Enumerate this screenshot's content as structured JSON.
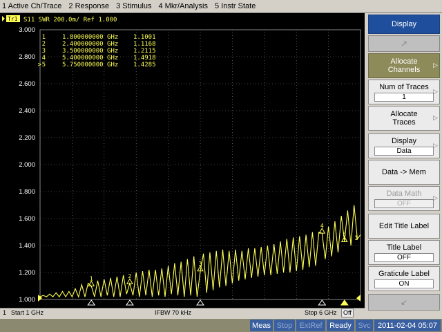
{
  "menu": [
    {
      "label": "1 Active Ch/Trace"
    },
    {
      "label": "2 Response"
    },
    {
      "label": "3 Stimulus"
    },
    {
      "label": "4 Mkr/Analysis"
    },
    {
      "label": "5 Instr State"
    }
  ],
  "trace": {
    "badge": "Tr1",
    "info": "S11  SWR 200.0m/ Ref 1.000",
    "color": "#ffff55"
  },
  "markers": [
    {
      "index": "1",
      "prefix": "",
      "freq": "1.800000000 GHz",
      "value": "1.1001"
    },
    {
      "index": "2",
      "prefix": "",
      "freq": "2.400000000 GHz",
      "value": "1.1168"
    },
    {
      "index": "3",
      "prefix": "",
      "freq": "3.500000000 GHz",
      "value": "1.2115"
    },
    {
      "index": "4",
      "prefix": "",
      "freq": "5.400000000 GHz",
      "value": "1.4918"
    },
    {
      "index": "5",
      "prefix": ">",
      "freq": "5.750000000 GHz",
      "value": "1.4285"
    }
  ],
  "chart_data": {
    "type": "line",
    "title": "S11  SWR 200.0m/ Ref 1.000",
    "xlabel": "",
    "ylabel": "",
    "xlim": [
      1,
      6
    ],
    "ylim": [
      1.0,
      3.0
    ],
    "yticks": [
      "3.000",
      "2.800",
      "2.600",
      "2.400",
      "2.200",
      "2.000",
      "1.800",
      "1.600",
      "1.400",
      "1.200",
      "1.000"
    ],
    "grid": true,
    "series": [
      {
        "points": [
          [
            1.0,
            1.02
          ],
          [
            1.05,
            1.03
          ],
          [
            1.1,
            1.02
          ],
          [
            1.15,
            1.04
          ],
          [
            1.2,
            1.02
          ],
          [
            1.25,
            1.05
          ],
          [
            1.3,
            1.02
          ],
          [
            1.35,
            1.06
          ],
          [
            1.4,
            1.02
          ],
          [
            1.45,
            1.06
          ],
          [
            1.5,
            1.02
          ],
          [
            1.55,
            1.08
          ],
          [
            1.6,
            1.02
          ],
          [
            1.65,
            1.11
          ],
          [
            1.7,
            1.02
          ],
          [
            1.75,
            1.12
          ],
          [
            1.8,
            1.1
          ],
          [
            1.85,
            1.02
          ],
          [
            1.9,
            1.14
          ],
          [
            1.95,
            1.02
          ],
          [
            2.0,
            1.15
          ],
          [
            2.05,
            1.03
          ],
          [
            2.1,
            1.16
          ],
          [
            2.15,
            1.02
          ],
          [
            2.2,
            1.17
          ],
          [
            2.25,
            1.02
          ],
          [
            2.3,
            1.18
          ],
          [
            2.35,
            1.04
          ],
          [
            2.4,
            1.12
          ],
          [
            2.45,
            1.03
          ],
          [
            2.5,
            1.2
          ],
          [
            2.55,
            1.02
          ],
          [
            2.6,
            1.21
          ],
          [
            2.65,
            1.03
          ],
          [
            2.7,
            1.22
          ],
          [
            2.75,
            1.02
          ],
          [
            2.8,
            1.22
          ],
          [
            2.85,
            1.03
          ],
          [
            2.9,
            1.23
          ],
          [
            2.95,
            1.02
          ],
          [
            3.0,
            1.25
          ],
          [
            3.05,
            1.04
          ],
          [
            3.1,
            1.27
          ],
          [
            3.15,
            1.03
          ],
          [
            3.2,
            1.28
          ],
          [
            3.25,
            1.02
          ],
          [
            3.3,
            1.3
          ],
          [
            3.35,
            1.03
          ],
          [
            3.4,
            1.32
          ],
          [
            3.45,
            1.02
          ],
          [
            3.5,
            1.21
          ],
          [
            3.55,
            1.34
          ],
          [
            3.6,
            1.05
          ],
          [
            3.65,
            1.35
          ],
          [
            3.7,
            1.07
          ],
          [
            3.75,
            1.36
          ],
          [
            3.8,
            1.09
          ],
          [
            3.85,
            1.37
          ],
          [
            3.9,
            1.1
          ],
          [
            3.95,
            1.36
          ],
          [
            4.0,
            1.12
          ],
          [
            4.05,
            1.37
          ],
          [
            4.1,
            1.14
          ],
          [
            4.15,
            1.36
          ],
          [
            4.2,
            1.15
          ],
          [
            4.25,
            1.38
          ],
          [
            4.3,
            1.16
          ],
          [
            4.35,
            1.38
          ],
          [
            4.4,
            1.17
          ],
          [
            4.45,
            1.39
          ],
          [
            4.5,
            1.18
          ],
          [
            4.55,
            1.4
          ],
          [
            4.6,
            1.18
          ],
          [
            4.65,
            1.41
          ],
          [
            4.7,
            1.19
          ],
          [
            4.75,
            1.43
          ],
          [
            4.8,
            1.2
          ],
          [
            4.85,
            1.45
          ],
          [
            4.9,
            1.2
          ],
          [
            4.95,
            1.46
          ],
          [
            5.0,
            1.21
          ],
          [
            5.05,
            1.47
          ],
          [
            5.1,
            1.22
          ],
          [
            5.15,
            1.48
          ],
          [
            5.2,
            1.24
          ],
          [
            5.25,
            1.5
          ],
          [
            5.3,
            1.25
          ],
          [
            5.35,
            1.5
          ],
          [
            5.4,
            1.49
          ],
          [
            5.45,
            1.3
          ],
          [
            5.5,
            1.54
          ],
          [
            5.55,
            1.32
          ],
          [
            5.6,
            1.58
          ],
          [
            5.65,
            1.35
          ],
          [
            5.7,
            1.62
          ],
          [
            5.75,
            1.43
          ],
          [
            5.8,
            1.66
          ],
          [
            5.85,
            1.4
          ],
          [
            5.9,
            1.7
          ],
          [
            5.95,
            1.45
          ],
          [
            6.0,
            1.48
          ]
        ]
      }
    ],
    "marker_points": [
      {
        "label": "1",
        "x": 1.8,
        "y": 1.1001
      },
      {
        "label": "2",
        "x": 2.4,
        "y": 1.1168
      },
      {
        "label": "3",
        "x": 3.5,
        "y": 1.2115
      },
      {
        "label": "4",
        "x": 5.4,
        "y": 1.4918
      },
      {
        "label": "5",
        "x": 5.75,
        "y": 1.4285
      }
    ],
    "end_label": "1"
  },
  "status": {
    "channel": "1",
    "start": "Start 1 GHz",
    "ifbw": "IFBW 70 kHz",
    "stop": "Stop 6 GHz",
    "off": "Off"
  },
  "status_bar": {
    "meas": "Meas",
    "stop": "Stop",
    "extref": "ExtRef",
    "ready": "Ready",
    "svc": "Svc",
    "datetime": "2011-02-04 05:07"
  },
  "softkeys": {
    "title": "Display",
    "allocate_channels": "Allocate Channels",
    "num_traces": {
      "label": "Num of Traces",
      "value": "1"
    },
    "allocate_traces": "Allocate Traces",
    "display": {
      "label": "Display",
      "value": "Data"
    },
    "data_to_mem": "Data -> Mem",
    "data_math": {
      "label": "Data Math",
      "value": "OFF"
    },
    "edit_title_label": "Edit Title Label",
    "title_label": {
      "label": "Title Label",
      "value": "OFF"
    },
    "graticule_label": {
      "label": "Graticule Label",
      "value": "ON"
    }
  },
  "colors": {
    "trace": "#ffff55",
    "grid": "#8a8a8a",
    "background": "#000000",
    "softkey_title": "#1f4e9c",
    "softkey_active": "#8e8b5a",
    "status_cell": "#3a5fa0"
  }
}
